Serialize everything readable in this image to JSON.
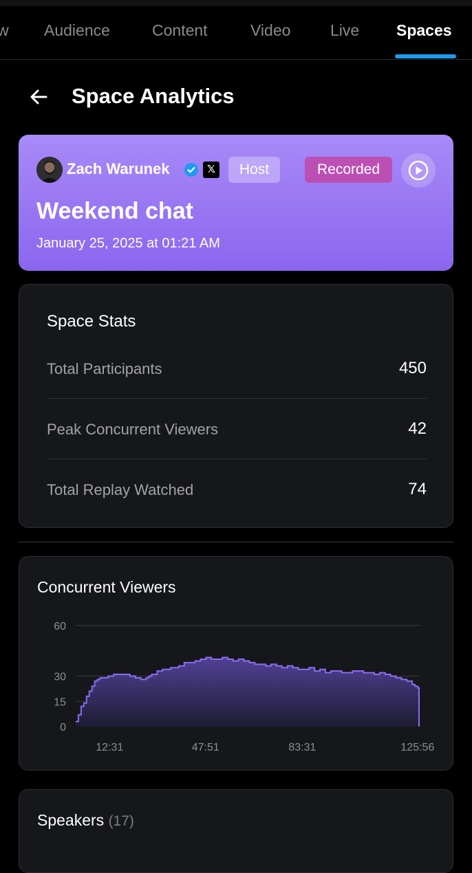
{
  "tabs": [
    {
      "label": "w"
    },
    {
      "label": "Audience"
    },
    {
      "label": "Content"
    },
    {
      "label": "Video"
    },
    {
      "label": "Live"
    },
    {
      "label": "Spaces",
      "active": true
    }
  ],
  "header": {
    "title": "Space Analytics",
    "back_icon": "arrow-left-icon"
  },
  "space": {
    "host_name": "Zach Warunek",
    "host_badge": "Host",
    "status_badge": "Recorded",
    "title": "Weekend chat",
    "date": "January 25, 2025 at 01:21 AM",
    "verified_icon": "verified-badge-icon",
    "platform_icon": "x-logo-icon",
    "play_icon": "play-circle-icon"
  },
  "stats": {
    "title": "Space Stats",
    "rows": [
      {
        "label": "Total Participants",
        "value": "450"
      },
      {
        "label": "Peak Concurrent Viewers",
        "value": "42"
      },
      {
        "label": "Total Replay Watched",
        "value": "74"
      }
    ]
  },
  "chart": {
    "title": "Concurrent Viewers"
  },
  "chart_data": {
    "type": "area",
    "title": "Concurrent Viewers",
    "xlabel": "",
    "ylabel": "",
    "ylim": [
      0,
      60
    ],
    "xlim": [
      0,
      127
    ],
    "yticks": [
      0,
      15,
      30,
      60
    ],
    "xtick_labels": [
      "12:31",
      "47:51",
      "83:31",
      "125:56"
    ],
    "xtick_values": [
      12.5,
      47.85,
      83.5,
      125.93
    ],
    "grid": true,
    "legend": "none",
    "series": [
      {
        "color": "#8c6cf2",
        "x": [
          0,
          1,
          2,
          3,
          4,
          5,
          6,
          7,
          8,
          9,
          10,
          12,
          14,
          16,
          18,
          20,
          22,
          24,
          25,
          26,
          27,
          28,
          30,
          32,
          35,
          38,
          40,
          42,
          44,
          46,
          48,
          50,
          52,
          54,
          56,
          58,
          60,
          62,
          64,
          66,
          68,
          70,
          72,
          74,
          76,
          78,
          80,
          82,
          84,
          86,
          88,
          90,
          92,
          94,
          96,
          98,
          100,
          102,
          104,
          106,
          108,
          110,
          112,
          114,
          116,
          118,
          120,
          122,
          124,
          125,
          126,
          126.5
        ],
        "y": [
          3,
          7,
          12,
          14,
          18,
          21,
          24,
          27,
          28,
          29,
          29,
          30,
          31,
          31,
          31,
          30,
          29,
          28,
          28,
          29,
          30,
          31,
          33,
          34,
          35,
          36,
          38,
          38,
          39,
          40,
          41,
          40,
          40,
          41,
          40,
          39,
          40,
          39,
          38,
          37,
          37,
          36,
          37,
          36,
          35,
          36,
          35,
          34,
          34,
          35,
          33,
          34,
          32,
          33,
          33,
          32,
          32,
          33,
          33,
          32,
          32,
          31,
          32,
          31,
          30,
          29,
          28,
          27,
          25,
          24,
          23,
          0
        ]
      }
    ]
  },
  "speakers": {
    "title": "Speakers",
    "count": "(17)"
  },
  "colors": {
    "accent": "#1d9bf0",
    "hero_gradient_top": "#a88af8",
    "hero_gradient_bottom": "#8b66ee",
    "recorded_badge": "#bc4fb3",
    "chart_line": "#8c6cf2",
    "card_bg": "#16171b"
  }
}
